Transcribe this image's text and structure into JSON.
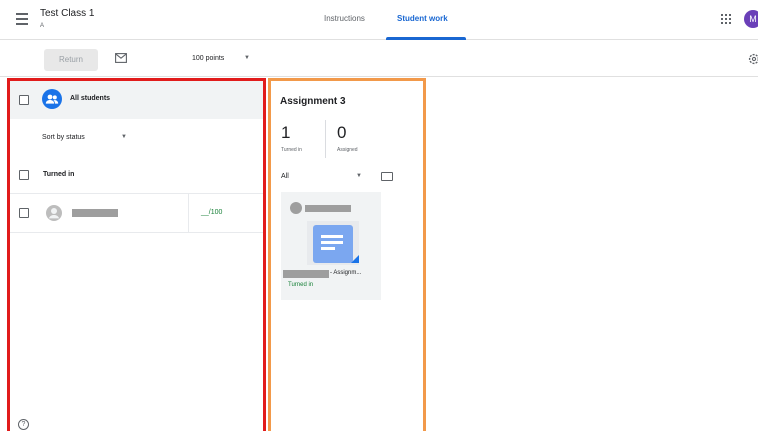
{
  "header": {
    "class_title": "Test Class 1",
    "class_section": "A",
    "tabs": [
      {
        "label": "Instructions",
        "active": false
      },
      {
        "label": "Student work",
        "active": true
      }
    ],
    "avatar_letter": "M",
    "accent_color": "#1967d2",
    "avatar_color": "#6a3fb8"
  },
  "toolbar": {
    "return_label": "Return",
    "points_value": "100 points",
    "icons": [
      "mail-icon",
      "settings-icon"
    ]
  },
  "left_panel": {
    "all_students_label": "All students",
    "sort_label": "Sort by status",
    "section_label": "Turned in",
    "students": [
      {
        "grade": "__/100"
      }
    ],
    "highlight_color": "#e11b1b"
  },
  "assignment": {
    "title": "Assignment 3",
    "turned_in_count": "1",
    "turned_in_label": "Turned in",
    "assigned_count": "0",
    "assigned_label": "Assigned",
    "filter_value": "All",
    "card": {
      "caption": "- Assignm...",
      "status": "Turned in"
    },
    "highlight_color": "#f2994a"
  }
}
